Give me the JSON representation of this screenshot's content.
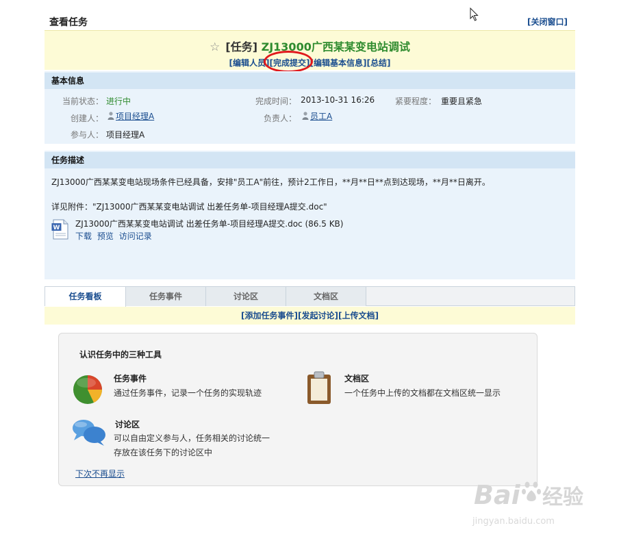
{
  "header": {
    "title": "查看任务",
    "close_label": "[关闭窗口]"
  },
  "task": {
    "bracket": "[任务]",
    "code_title": "ZJ13000广西某某变电站调试",
    "actions": [
      "[编辑人员]",
      "[完成提交]",
      "[编辑基本信息]",
      "[总结]"
    ]
  },
  "basic_info": {
    "section_title": "基本信息",
    "status_label": "当前状态：",
    "status_value": "进行中",
    "finish_label": "完成时间：",
    "finish_value": "2013-10-31 16:26",
    "urgency_label": "紧要程度：",
    "urgency_value": "重要且紧急",
    "creator_label": "创建人：",
    "creator_value": "项目经理A",
    "owner_label": "负责人：",
    "owner_value": "员工A",
    "participants_label": "参与人：",
    "participants_value": "项目经理A"
  },
  "description": {
    "section_title": "任务描述",
    "text": "ZJ13000广西某某变电站现场条件已经具备，安排\"员工A\"前往，预计2工作日，**月**日**点到达现场，**月**日离开。",
    "attachment_ref": "详见附件：\"ZJ13000广西某某变电站调试 出差任务单-项目经理A提交.doc\"",
    "attachment_name": "ZJ13000广西某某变电站调试 出差任务单-项目经理A提交.doc (86.5 KB)",
    "attachment_actions": [
      "下载",
      "预览",
      "访问记录"
    ]
  },
  "tabs": [
    "任务看板",
    "任务事件",
    "讨论区",
    "文档区"
  ],
  "tab_actions": [
    "[添加任务事件]",
    "[发起讨论]",
    "[上传文档]"
  ],
  "tools": {
    "title": "认识任务中的三种工具",
    "items": [
      {
        "name": "任务事件",
        "desc": "通过任务事件，记录一个任务的实现轨迹",
        "icon": "pie-chart-icon"
      },
      {
        "name": "文档区",
        "desc": "一个任务中上传的文档都在文档区统一显示",
        "icon": "clipboard-icon"
      },
      {
        "name": "讨论区",
        "desc_line1": "可以自由定义参与人，任务相关的讨论统一",
        "desc_line2": "存放在该任务下的讨论区中",
        "icon": "chat-bubbles-icon"
      }
    ],
    "hide_label": "下次不再显示"
  },
  "watermark": {
    "text": "Bai经验",
    "sub": "jingyan.baidu.com"
  },
  "colors": {
    "accent_link": "#1a4d8f",
    "status_green": "#2e8b2e",
    "highlight_red": "#e0191c",
    "title_bg": "#fdfbd6",
    "section_bg": "#d3e5f4"
  }
}
